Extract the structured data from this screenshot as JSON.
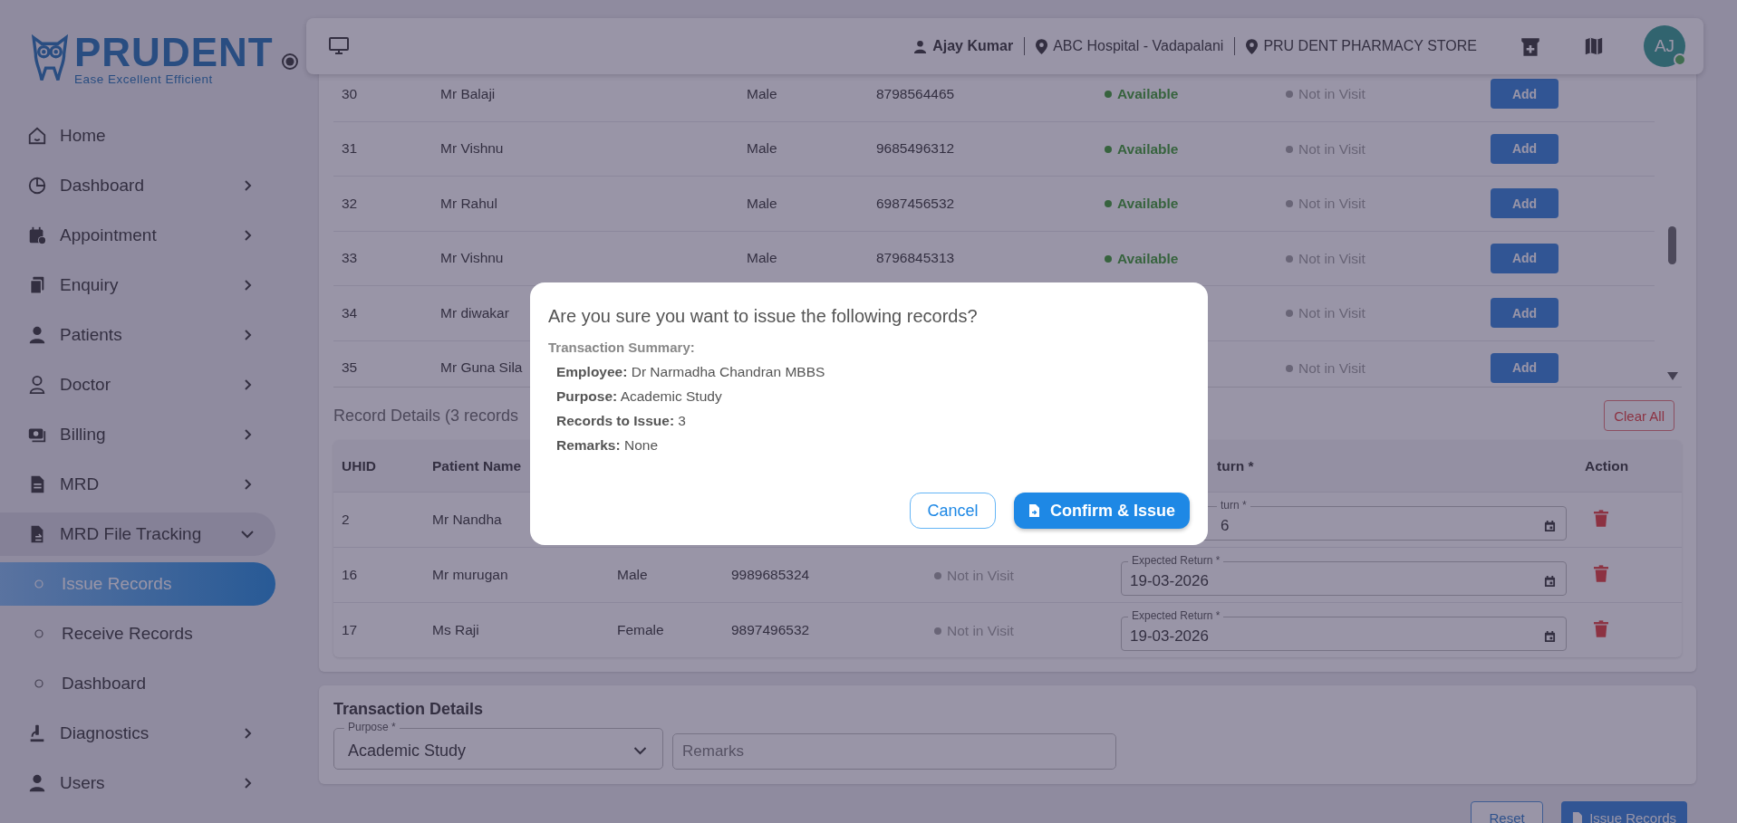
{
  "sidebar": {
    "logo": {
      "name": "PRUDENT",
      "tagline": "Ease Excellent Efficient"
    },
    "items": [
      {
        "label": "Home"
      },
      {
        "label": "Dashboard",
        "expanded": false
      },
      {
        "label": "Appointment",
        "expanded": false
      },
      {
        "label": "Enquiry",
        "expanded": false
      },
      {
        "label": "Patients",
        "expanded": false
      },
      {
        "label": "Doctor",
        "expanded": false
      },
      {
        "label": "Billing",
        "expanded": false
      },
      {
        "label": "MRD",
        "expanded": false
      },
      {
        "label": "MRD File Tracking",
        "expanded": true,
        "children": [
          {
            "label": "Issue Records",
            "selected": true
          },
          {
            "label": "Receive Records",
            "selected": false
          },
          {
            "label": "Dashboard",
            "selected": false
          }
        ]
      },
      {
        "label": "Diagnostics",
        "expanded": false
      },
      {
        "label": "Users",
        "expanded": false
      }
    ]
  },
  "header": {
    "user": "Ajay Kumar",
    "hospital": "ABC Hospital - Vadapalani",
    "store": "PRU DENT PHARMACY STORE",
    "avatar": "AJ",
    "online": true
  },
  "patients_table": {
    "rows": [
      {
        "uhid": "30",
        "name": "Mr Balaji",
        "gender": "Male",
        "phone": "8798564465",
        "status": "Available",
        "visit": "Not in Visit",
        "action": "Add"
      },
      {
        "uhid": "31",
        "name": "Mr Vishnu",
        "gender": "Male",
        "phone": "9685496312",
        "status": "Available",
        "visit": "Not in Visit",
        "action": "Add"
      },
      {
        "uhid": "32",
        "name": "Mr Rahul",
        "gender": "Male",
        "phone": "6987456532",
        "status": "Available",
        "visit": "Not in Visit",
        "action": "Add"
      },
      {
        "uhid": "33",
        "name": "Mr Vishnu",
        "gender": "Male",
        "phone": "8796845313",
        "status": "Available",
        "visit": "Not in Visit",
        "action": "Add"
      },
      {
        "uhid": "34",
        "name": "Mr diwakar",
        "visit": "Not in Visit",
        "action": "Add"
      },
      {
        "uhid": "35",
        "name": "Mr Guna Sila",
        "visit": "Not in Visit",
        "action": "Add"
      }
    ]
  },
  "record_details": {
    "title": "Record Details (3 records",
    "clear_button": "Clear All",
    "columns": {
      "uhid": "UHID",
      "patient_name": "Patient Name",
      "expected_return": "turn *",
      "action": "Action"
    },
    "rows": [
      {
        "uhid": "2",
        "name": "Mr Nandha",
        "expected_return": {
          "label": "turn *",
          "value": "6"
        }
      },
      {
        "uhid": "16",
        "name": "Mr murugan",
        "gender": "Male",
        "phone": "9989685324",
        "visit": "Not in Visit",
        "expected_return": {
          "label": "Expected Return *",
          "value": "19-03-2026"
        }
      },
      {
        "uhid": "17",
        "name": "Ms Raji",
        "gender": "Female",
        "phone": "9897496532",
        "visit": "Not in Visit",
        "expected_return": {
          "label": "Expected Return *",
          "value": "19-03-2026"
        }
      }
    ]
  },
  "transaction_details": {
    "title": "Transaction Details",
    "purpose": {
      "label": "Purpose *",
      "value": "Academic Study"
    },
    "remarks": {
      "placeholder": "Remarks"
    }
  },
  "footer_buttons": {
    "reset": "Reset",
    "issue": "Issue Records"
  },
  "dialog": {
    "title": "Are you sure you want to issue the following records?",
    "summary_title": "Transaction Summary:",
    "lines": [
      "**Employee:** Dr Narmadha Chandran MBBS",
      "**Purpose:** Academic Study",
      "**Records to Issue:** 3",
      "**Remarks:** None"
    ],
    "cancel": "Cancel",
    "confirm": "Confirm & Issue"
  }
}
